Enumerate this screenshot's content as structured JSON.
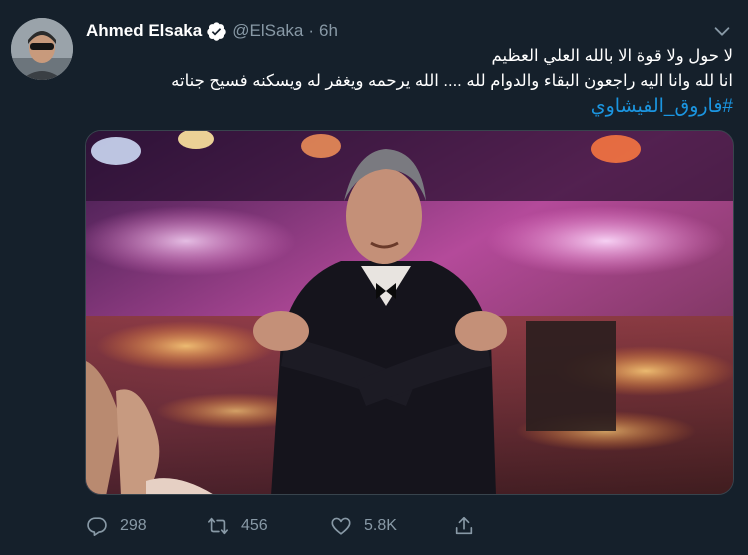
{
  "tweet": {
    "author": {
      "display_name": "Ahmed Elsaka",
      "verified_icon": "verified-badge-icon",
      "handle": "@ElSaka",
      "separator": "·",
      "time": "6h"
    },
    "text_lines": [
      "لا حول ولا قوة الا بالله العلي العظيم",
      "انا لله وانا اليه راجعون البقاء والدوام لله  .... الله يرحمه ويغفر له ويسكنه فسيح جناته"
    ],
    "hashtag": "#فاروق_الفيشاوي",
    "media": {
      "description_icon": "photo-image"
    },
    "actions": {
      "reply_count": "298",
      "retweet_count": "456",
      "like_count": "5.8K"
    },
    "colors": {
      "background": "#15202b",
      "accent": "#1b95e0",
      "muted": "#8899a6",
      "border": "#38444d"
    }
  }
}
